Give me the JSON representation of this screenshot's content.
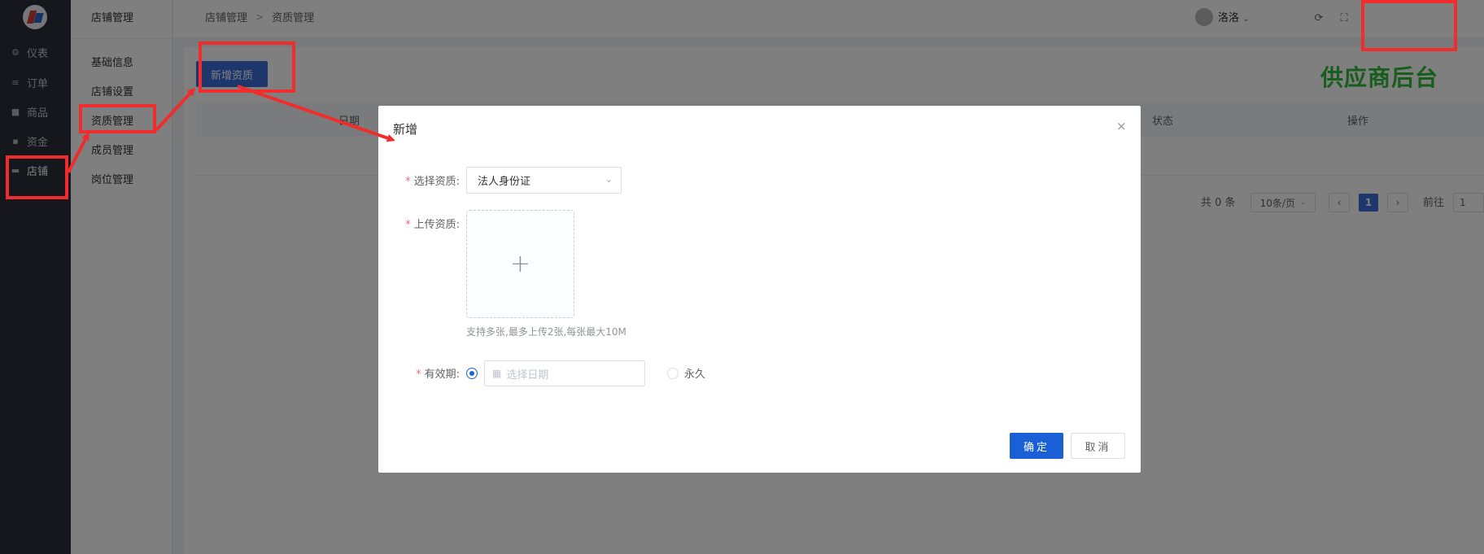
{
  "rail": {
    "items": [
      {
        "label": "仪表",
        "icon": "dashboard-icon"
      },
      {
        "label": "订单",
        "icon": "list-icon"
      },
      {
        "label": "商品",
        "icon": "goods-icon"
      },
      {
        "label": "资金",
        "icon": "funds-icon"
      },
      {
        "label": "店铺",
        "icon": "shop-icon",
        "active": true
      }
    ]
  },
  "submenu": {
    "title": "店铺管理",
    "items": [
      "基础信息",
      "店铺设置",
      "资质管理",
      "成员管理",
      "岗位管理"
    ]
  },
  "header": {
    "breadcrumb": [
      "店铺管理",
      "资质管理"
    ],
    "breadcrumb_sep": ">",
    "user_name": "洛洛",
    "refresh_icon": "refresh-icon",
    "fullscreen_icon": "fullscreen-icon"
  },
  "main": {
    "add_button": "新增资质",
    "columns": [
      "日期",
      "状态",
      "操作"
    ],
    "pagination": {
      "total_text": "共 0 条",
      "page_size": "10条/页",
      "current_page": "1",
      "goto_label": "前往",
      "goto_value": "1"
    }
  },
  "brand_text": "供应商后台",
  "modal": {
    "title": "新增",
    "close": "×",
    "fields": {
      "qual_label": "选择资质:",
      "qual_value": "法人身份证",
      "upload_label": "上传资质:",
      "upload_hint": "支持多张,最多上传2张,每张最大10M",
      "validity_label": "有效期:",
      "date_placeholder": "选择日期",
      "forever_label": "永久"
    },
    "ok": "确定",
    "cancel": "取消"
  },
  "colors": {
    "primary": "#1a5fd6",
    "annotation": "#f02c2c",
    "brand_green": "#2ebd3a"
  }
}
